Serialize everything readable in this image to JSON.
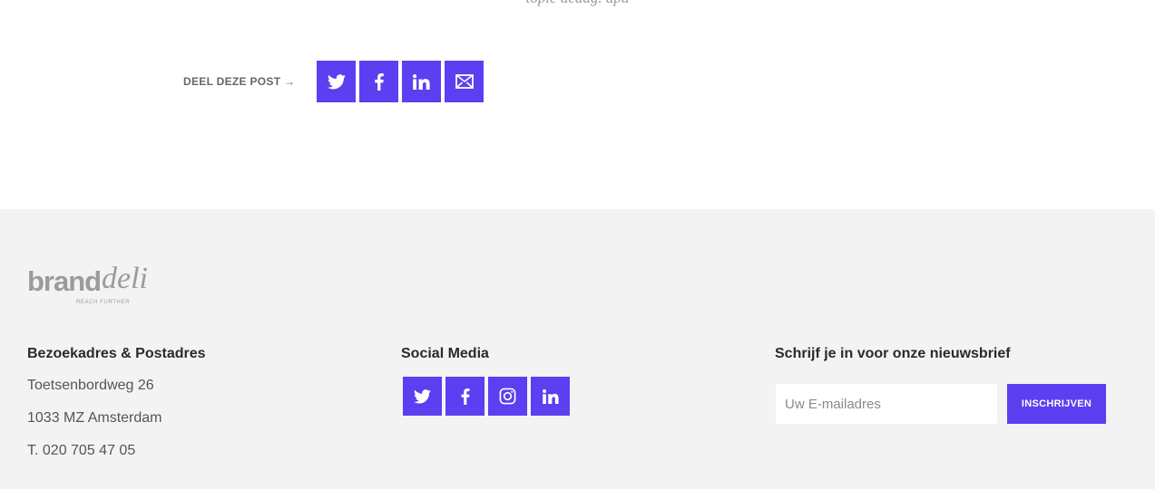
{
  "post": {
    "caption_cut": "topic dedag. dpa"
  },
  "share": {
    "label": "DEEL DEZE POST →",
    "buttons": [
      {
        "icon": "twitter-icon"
      },
      {
        "icon": "facebook-icon"
      },
      {
        "icon": "linkedin-icon"
      },
      {
        "icon": "mail-icon"
      }
    ]
  },
  "footer": {
    "logo": {
      "brand": "brand",
      "script": "deli",
      "tagline": "REACH FURTHER"
    },
    "address": {
      "title": "Bezoekadres & Postadres",
      "street": "Toetsenbordweg 26",
      "city": "1033 MZ Amsterdam",
      "phone": "T. 020 705 47 05"
    },
    "social": {
      "title": "Social Media",
      "buttons": [
        {
          "icon": "twitter-icon"
        },
        {
          "icon": "facebook-icon"
        },
        {
          "icon": "instagram-icon"
        },
        {
          "icon": "linkedin-icon"
        }
      ]
    },
    "newsletter": {
      "title": "Schrijf je in voor onze nieuwsbrief",
      "placeholder": "Uw E-mailadres",
      "button_label": "INSCHRIJVEN"
    }
  },
  "colors": {
    "accent": "#5b3ff0",
    "footer_bg": "#f3f3f3"
  }
}
